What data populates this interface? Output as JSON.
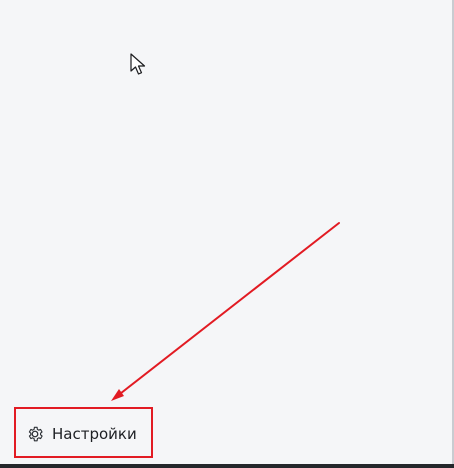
{
  "screen": {
    "background_color": "#f5f6f8",
    "accent_color": "#e21b23"
  },
  "cursor": {
    "icon": "arrow-cursor-icon"
  },
  "annotation": {
    "arrow_icon": "arrow-icon",
    "arrow_color": "#e21b23"
  },
  "sidebar": {
    "settings_item": {
      "icon": "gear-icon",
      "label": "Настройки"
    }
  }
}
